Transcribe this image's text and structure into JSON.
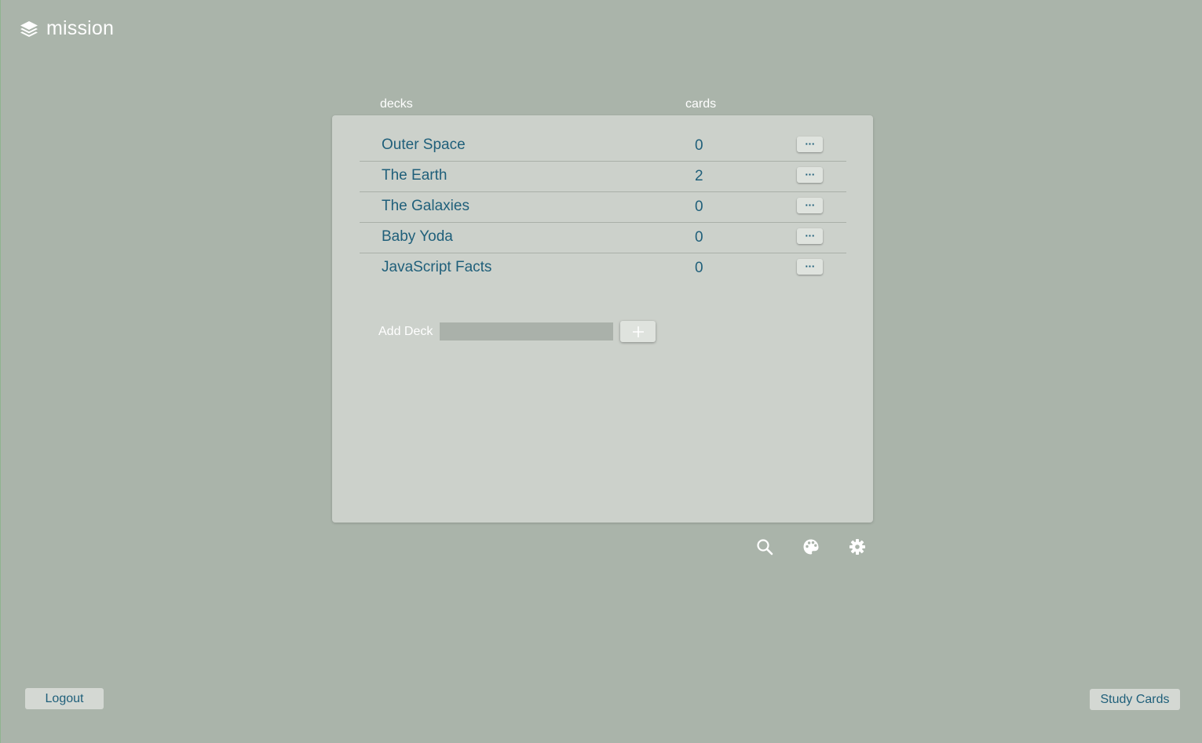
{
  "app": {
    "name": "mission",
    "logo_icon": "layers-icon"
  },
  "columns": {
    "decks": "decks",
    "cards": "cards"
  },
  "decks": [
    {
      "name": "Outer Space",
      "cards": "0",
      "menu": "···"
    },
    {
      "name": "The Earth",
      "cards": "2",
      "menu": "···"
    },
    {
      "name": "The Galaxies",
      "cards": "0",
      "menu": "···"
    },
    {
      "name": "Baby Yoda",
      "cards": "0",
      "menu": "···"
    },
    {
      "name": "JavaScript Facts",
      "cards": "0",
      "menu": "···"
    }
  ],
  "add_deck": {
    "label": "Add Deck",
    "value": "",
    "placeholder": "",
    "button_icon": "plus-icon"
  },
  "toolbar": {
    "icons": [
      "search-icon",
      "palette-icon",
      "gear-icon"
    ]
  },
  "footer": {
    "logout_label": "Logout",
    "study_label": "Study Cards"
  },
  "colors": {
    "background": "#aab4aa",
    "panel": "#ccd1cb",
    "accent_text": "#1f5f7a",
    "button": "#d4d8d3"
  }
}
